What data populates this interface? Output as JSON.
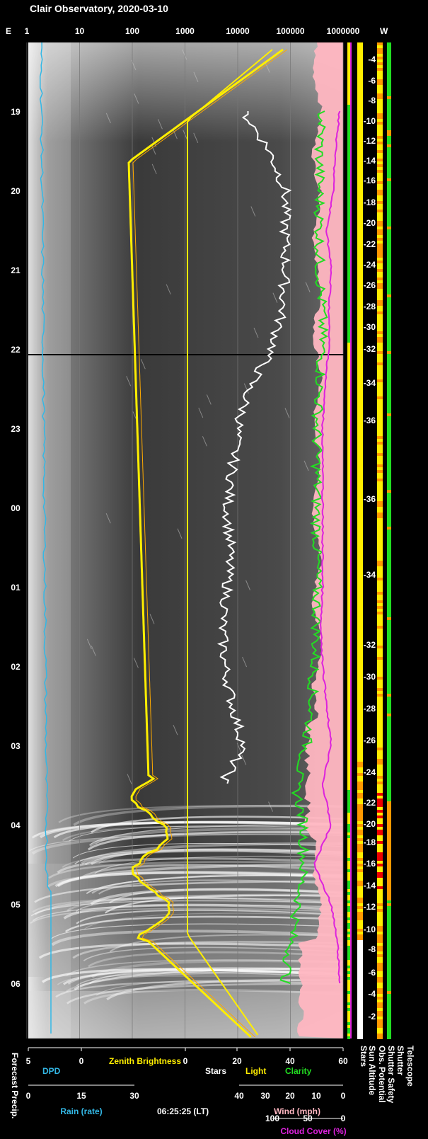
{
  "title": "Clair Observatory, 2020-03-10",
  "timestamp": "06:25:25 (LT)",
  "colors": {
    "dpd": "#33b8e6",
    "zenith": "#ffee00",
    "light": "#ffee00",
    "stars": "#ffffff",
    "clarity": "#22dd22",
    "cloud_cover": "#dd22dd",
    "wind": "#ffb6c1",
    "sun_altitude": "#ffee00",
    "obs_potential_ok": "#22dd22",
    "obs_potential_warn": "#ff9900",
    "unsafe": "#ee0000"
  },
  "chart_data": {
    "type": "line",
    "top_axis": {
      "left_label": "E",
      "right_label": "W",
      "ticks": [
        "1",
        "10",
        "100",
        "1000",
        "10000",
        "100000",
        "1000000"
      ]
    },
    "time_axis": {
      "ticks": [
        "19",
        "20",
        "21",
        "22",
        "23",
        "00",
        "01",
        "02",
        "03",
        "04",
        "05",
        "06"
      ]
    },
    "sun_altitude_ticks": [
      "-4",
      "-6",
      "-8",
      "-10",
      "-12",
      "-14",
      "-16",
      "-18",
      "-20",
      "-22",
      "-24",
      "-26",
      "-28",
      "-30",
      "-32",
      "-34",
      "-36",
      "-36",
      "-34",
      "-32",
      "-30",
      "-28",
      "-26",
      "-24",
      "-22",
      "-20",
      "-18",
      "-16",
      "-14",
      "-12",
      "-10",
      "-8",
      "-6",
      "-4",
      "-2"
    ],
    "bottom_axes": {
      "row1": {
        "ticks": [
          "5",
          "0",
          "0",
          "20",
          "40",
          "60"
        ],
        "labels": {
          "dpd": "DPD",
          "zenith": "Zenith Brightness",
          "stars": "Stars",
          "light": "Light",
          "clarity": "Clarity"
        }
      },
      "row2": {
        "rain_ticks": [
          "0",
          "15",
          "30"
        ],
        "rain_label": "Rain (rate)",
        "wind_ticks": [
          "40",
          "30",
          "20",
          "10",
          "0"
        ],
        "wind_label": "Wind (mph)"
      },
      "row3": {
        "cloud_ticks": [
          "100",
          "50",
          "0"
        ],
        "cloud_label": "Cloud Cover (%)"
      }
    },
    "side_labels": {
      "left": "Forecast Precip.",
      "right": [
        "Stars",
        "Sun Altitude",
        "Obs. Potential",
        "Shutter Safety",
        "Shutter",
        "Telescope"
      ]
    },
    "series": [
      {
        "name": "Stars",
        "x_hours": [
          19.0,
          19.5,
          20.0,
          20.5,
          21.0,
          21.5,
          22.0,
          22.5,
          23.0,
          23.5,
          24.0,
          24.5,
          25.0,
          25.5,
          26.0,
          26.5,
          27.0,
          27.5
        ],
        "values": [
          22,
          32,
          38,
          38,
          38,
          37,
          33,
          24,
          20,
          18,
          16,
          17,
          16,
          14,
          15,
          18,
          22,
          14
        ]
      },
      {
        "name": "Clarity",
        "x_hours": [
          19.0,
          19.5,
          20.0,
          20.5,
          21.0,
          21.5,
          22.0,
          22.5,
          23.0,
          23.5,
          24.0,
          24.5,
          25.0,
          25.5,
          26.0,
          26.5,
          27.0,
          27.5,
          28.0,
          28.5,
          29.0,
          29.5,
          30.0
        ],
        "values": [
          52,
          51,
          51,
          51,
          51,
          52,
          52,
          51,
          50,
          50,
          50,
          50,
          50,
          50,
          49,
          48,
          46,
          42,
          45,
          45,
          43,
          40,
          38
        ]
      },
      {
        "name": "Cloud Cover",
        "x_hours": [
          19.0,
          19.5,
          20.0,
          20.5,
          21.0,
          21.5,
          22.0,
          22.5,
          23.0,
          23.5,
          24.0,
          24.5,
          25.0,
          25.5,
          26.0,
          26.5,
          27.0,
          27.5,
          28.0,
          28.5,
          29.0,
          29.5,
          30.0
        ],
        "values": [
          0,
          10,
          15,
          30,
          20,
          25,
          25,
          35,
          40,
          40,
          40,
          40,
          40,
          45,
          40,
          30,
          20,
          40,
          20,
          60,
          20,
          5,
          0
        ]
      }
    ]
  }
}
